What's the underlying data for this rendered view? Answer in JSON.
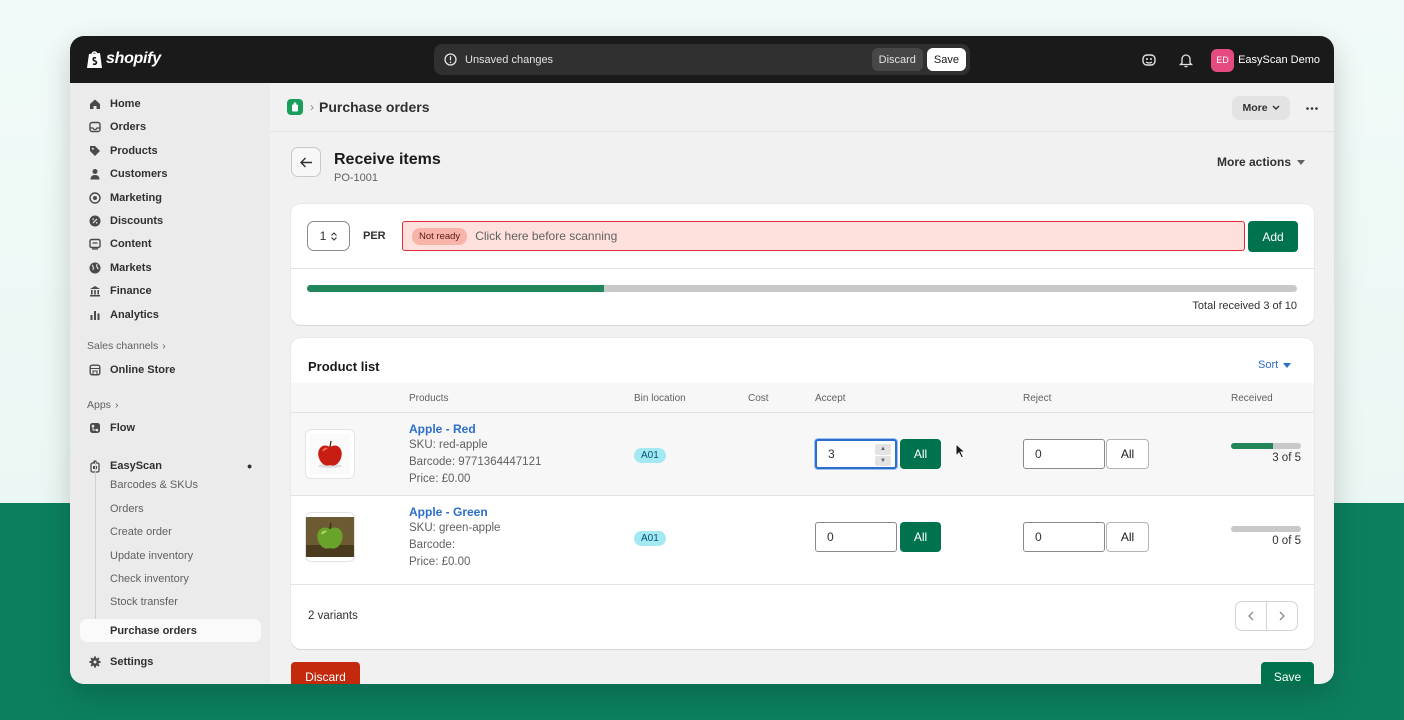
{
  "topbar": {
    "logo_text": "shopify",
    "unsaved_text": "Unsaved changes",
    "discard_label": "Discard",
    "save_label": "Save",
    "avatar_initials": "ED",
    "store_name": "EasyScan Demo"
  },
  "sidebar": {
    "items": [
      {
        "label": "Home",
        "icon": "home-icon"
      },
      {
        "label": "Orders",
        "icon": "inbox-icon"
      },
      {
        "label": "Products",
        "icon": "tag-icon"
      },
      {
        "label": "Customers",
        "icon": "person-icon"
      },
      {
        "label": "Marketing",
        "icon": "target-icon"
      },
      {
        "label": "Discounts",
        "icon": "discount-icon"
      },
      {
        "label": "Content",
        "icon": "content-icon"
      },
      {
        "label": "Markets",
        "icon": "globe-icon"
      },
      {
        "label": "Finance",
        "icon": "bank-icon"
      },
      {
        "label": "Analytics",
        "icon": "bar-chart-icon"
      }
    ],
    "sales_channels_label": "Sales channels",
    "online_store": "Online Store",
    "apps_label": "Apps",
    "flow": "Flow",
    "easyscan": "EasyScan",
    "easyscan_sub": [
      "Barcodes & SKUs",
      "Orders",
      "Create order",
      "Update inventory",
      "Check inventory",
      "Stock transfer",
      "Purchase orders"
    ],
    "settings": "Settings"
  },
  "header": {
    "breadcrumb": "Purchase orders",
    "more_label": "More"
  },
  "page": {
    "title": "Receive items",
    "subtitle": "PO-1001",
    "more_actions": "More actions"
  },
  "scan_card": {
    "quantity": "1",
    "per_label": "PER",
    "status_badge": "Not ready",
    "scan_placeholder": "Click here before scanning",
    "add_label": "Add",
    "progress": 0.3,
    "total_text": "Total received 3 of 10"
  },
  "product_list": {
    "title": "Product list",
    "sort_label": "Sort",
    "columns": [
      "Products",
      "Bin location",
      "Cost",
      "Accept",
      "Reject",
      "Received"
    ],
    "rows": [
      {
        "name": "Apple - Red",
        "sku": "SKU: red-apple",
        "barcode": "Barcode: 9771364447121",
        "price": "Price: £0.00",
        "bin": "A01",
        "accept": "3",
        "accept_all": "All",
        "reject": "0",
        "reject_all": "All",
        "received_fraction": 0.6,
        "received_text": "3 of 5"
      },
      {
        "name": "Apple - Green",
        "sku": "SKU: green-apple",
        "barcode": "Barcode:",
        "price": "Price: £0.00",
        "bin": "A01",
        "accept": "0",
        "accept_all": "All",
        "reject": "0",
        "reject_all": "All",
        "received_fraction": 0,
        "received_text": "0 of 5"
      }
    ],
    "variants_text": "2 variants"
  },
  "footer": {
    "discard_label": "Discard",
    "save_label": "Save"
  },
  "colors": {
    "primary": "#00734e",
    "critical": "#c4290e",
    "link": "#2c6ecb"
  }
}
